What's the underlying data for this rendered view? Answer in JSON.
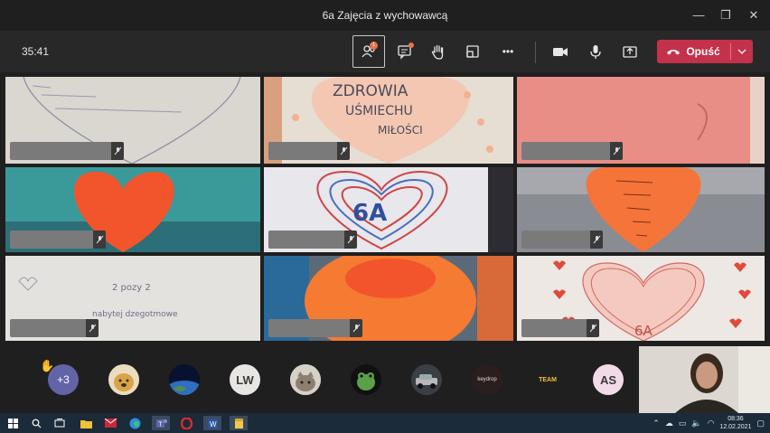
{
  "window": {
    "title": "6a Zajęcia z wychowawcą",
    "minimize": "—",
    "maximize": "❐",
    "close": "✕"
  },
  "toolbar": {
    "timer": "35:41",
    "participants_badge": "1",
    "leave_label": "Opuść",
    "more_label": "•••",
    "leave_color": "#c4314b"
  },
  "tiles": {
    "t2_text": [
      "ZDROWIA",
      "UŚMIECHU",
      "MIŁOŚCI"
    ],
    "t5_text": "6A",
    "t9_text": "6A",
    "t7_text": [
      "2 pozy 2",
      "nabytej dzegotmowe"
    ]
  },
  "participants": {
    "overflow": "+3",
    "items": [
      {
        "type": "more",
        "label": "+3"
      },
      {
        "type": "image",
        "icon": "doge-avatar"
      },
      {
        "type": "image",
        "icon": "earth-avatar"
      },
      {
        "type": "initials",
        "label": "LW"
      },
      {
        "type": "image",
        "icon": "cat-avatar"
      },
      {
        "type": "image",
        "icon": "frog-avatar"
      },
      {
        "type": "image",
        "icon": "car-avatar"
      },
      {
        "type": "image",
        "icon": "keydrop-avatar",
        "label": "keydrop"
      },
      {
        "type": "image",
        "icon": "team-logo-avatar",
        "label": "TEAM"
      },
      {
        "type": "initials",
        "label": "AS"
      }
    ]
  },
  "taskbar": {
    "time": "08:36",
    "date": "12.02.2021"
  }
}
